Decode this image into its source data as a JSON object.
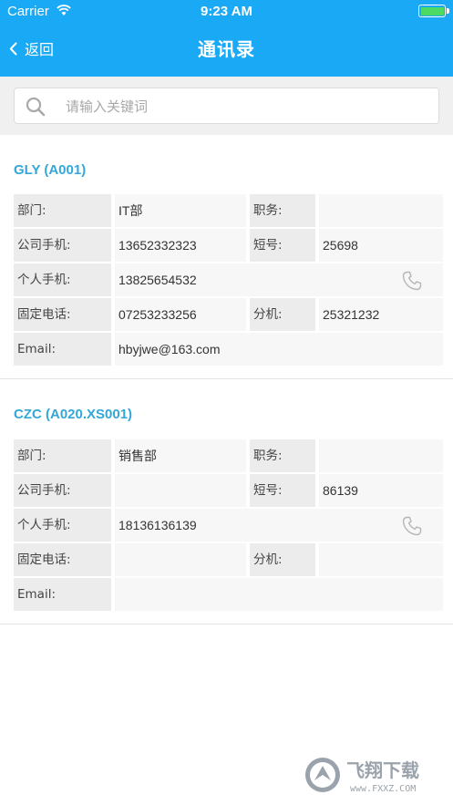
{
  "status": {
    "carrier": "Carrier",
    "time": "9:23 AM"
  },
  "nav": {
    "back_label": "返回",
    "title": "通讯录"
  },
  "search": {
    "placeholder": "请输入关键词"
  },
  "contacts": [
    {
      "title": "GLY (A001)",
      "dept_label": "部门:",
      "dept": "IT部",
      "position_label": "职务:",
      "position": "",
      "company_phone_label": "公司手机:",
      "company_phone": "13652332323",
      "short_label": "短号:",
      "short": "25698",
      "personal_phone_label": "个人手机:",
      "personal_phone": "13825654532",
      "landline_label": "固定电话:",
      "landline": "07253233256",
      "ext_label": "分机:",
      "ext": "25321232",
      "email_label": "Email:",
      "email": "hbyjwe@163.com"
    },
    {
      "title": "CZC (A020.XS001)",
      "dept_label": "部门:",
      "dept": "销售部",
      "position_label": "职务:",
      "position": "",
      "company_phone_label": "公司手机:",
      "company_phone": "",
      "short_label": "短号:",
      "short": "86139",
      "personal_phone_label": "个人手机:",
      "personal_phone": "18136136139",
      "landline_label": "固定电话:",
      "landline": "",
      "ext_label": "分机:",
      "ext": "",
      "email_label": "Email:",
      "email": ""
    }
  ],
  "watermark": {
    "text": "飞翔下载",
    "url_text": "www.FXXZ.COM"
  },
  "colors": {
    "accent": "#1aa9f5",
    "title": "#33a7d8",
    "label_bg": "#ececec",
    "value_bg": "#f7f7f7"
  }
}
